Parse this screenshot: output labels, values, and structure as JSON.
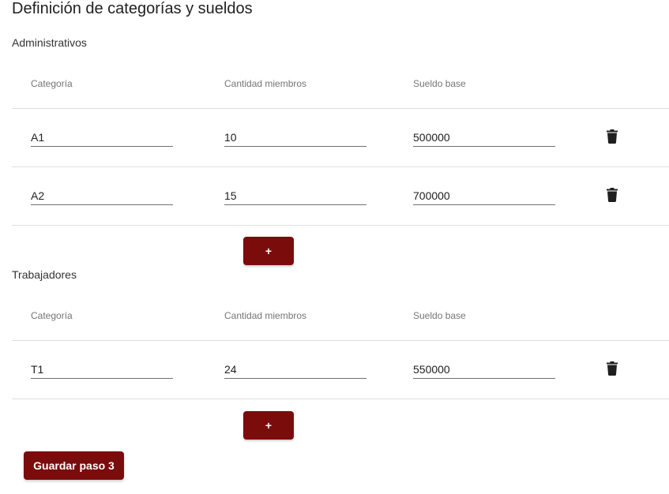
{
  "page": {
    "title": "Definición de categorías y sueldos"
  },
  "colors": {
    "accent": "#7a0c0c",
    "divider": "#e0e0e0",
    "header_text": "#757575"
  },
  "sections": [
    {
      "title": "Administrativos",
      "headers": {
        "category": "Categoría",
        "members": "Cantidad miembros",
        "salary": "Sueldo base"
      },
      "rows": [
        {
          "category": "A1",
          "members": "10",
          "salary": "500000",
          "delete_icon": "trash-icon"
        },
        {
          "category": "A2",
          "members": "15",
          "salary": "700000",
          "delete_icon": "trash-icon"
        }
      ],
      "add_label": "+"
    },
    {
      "title": "Trabajadores",
      "headers": {
        "category": "Categoría",
        "members": "Cantidad miembros",
        "salary": "Sueldo base"
      },
      "rows": [
        {
          "category": "T1",
          "members": "24",
          "salary": "550000",
          "delete_icon": "trash-icon"
        }
      ],
      "add_label": "+"
    }
  ],
  "actions": {
    "save_label": "Guardar paso 3"
  }
}
